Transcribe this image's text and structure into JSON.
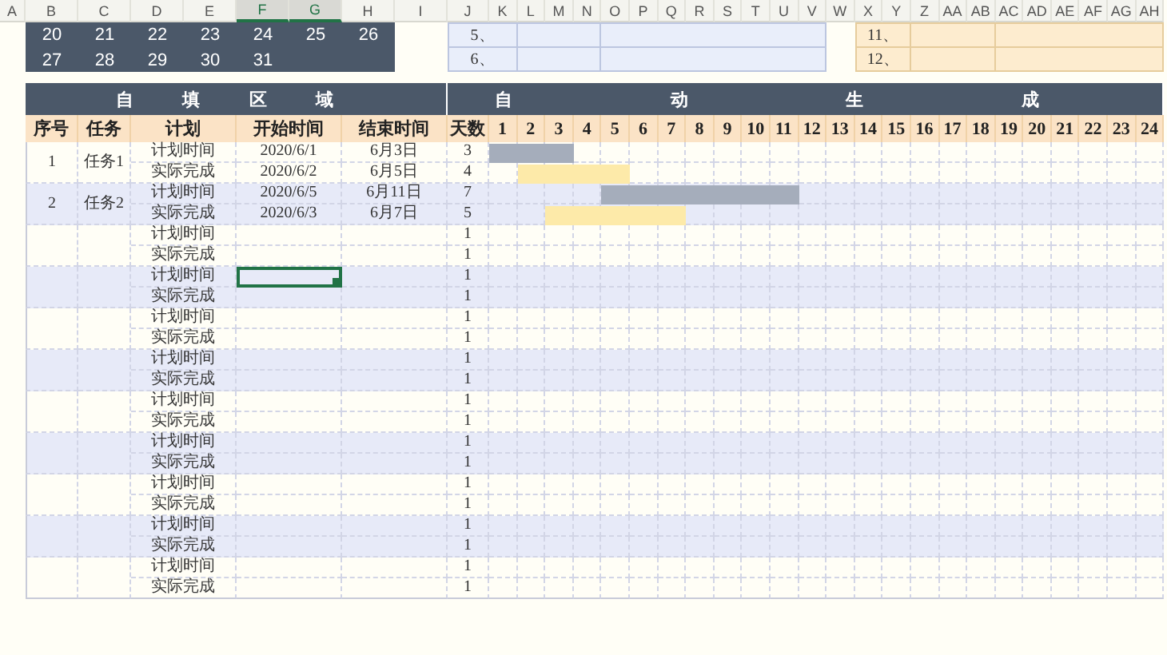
{
  "column_headers": [
    {
      "label": "A",
      "selected": false
    },
    {
      "label": "B",
      "selected": false
    },
    {
      "label": "C",
      "selected": false
    },
    {
      "label": "D",
      "selected": false
    },
    {
      "label": "E",
      "selected": false
    },
    {
      "label": "F",
      "selected": true
    },
    {
      "label": "G",
      "selected": true
    },
    {
      "label": "H",
      "selected": false
    },
    {
      "label": "I",
      "selected": false
    },
    {
      "label": "J",
      "selected": false
    },
    {
      "label": "K",
      "selected": false
    },
    {
      "label": "L",
      "selected": false
    },
    {
      "label": "M",
      "selected": false
    },
    {
      "label": "N",
      "selected": false
    },
    {
      "label": "O",
      "selected": false
    },
    {
      "label": "P",
      "selected": false
    },
    {
      "label": "Q",
      "selected": false
    },
    {
      "label": "R",
      "selected": false
    },
    {
      "label": "S",
      "selected": false
    },
    {
      "label": "T",
      "selected": false
    },
    {
      "label": "U",
      "selected": false
    },
    {
      "label": "V",
      "selected": false
    },
    {
      "label": "W",
      "selected": false
    },
    {
      "label": "X",
      "selected": false
    },
    {
      "label": "Y",
      "selected": false
    },
    {
      "label": "Z",
      "selected": false
    },
    {
      "label": "AA",
      "selected": false
    },
    {
      "label": "AB",
      "selected": false
    },
    {
      "label": "AC",
      "selected": false
    },
    {
      "label": "AD",
      "selected": false
    },
    {
      "label": "AE",
      "selected": false
    },
    {
      "label": "AF",
      "selected": false
    },
    {
      "label": "AG",
      "selected": false
    },
    {
      "label": "AH",
      "selected": false
    }
  ],
  "calendar": {
    "rows": [
      [
        "20",
        "21",
        "22",
        "23",
        "24",
        "25",
        "26"
      ],
      [
        "27",
        "28",
        "29",
        "30",
        "31"
      ]
    ]
  },
  "notes_left": [
    "5、",
    "6、"
  ],
  "notes_right": [
    "11、",
    "12、"
  ],
  "sections": [
    "自 填 区 域",
    "自 动 生 成"
  ],
  "table": {
    "columns": [
      "序号",
      "任务",
      "计划",
      "开始时间",
      "结束时间",
      "天数"
    ],
    "day_columns": [
      "1",
      "2",
      "3",
      "4",
      "5",
      "6",
      "7",
      "8",
      "9",
      "10",
      "11",
      "12",
      "13",
      "14",
      "15",
      "16",
      "17",
      "18",
      "19",
      "20",
      "21",
      "22",
      "23",
      "24"
    ],
    "tasks": [
      {
        "no": "1",
        "task": "任务1",
        "entries": [
          {
            "kind": "plan",
            "label": "计划时间",
            "start": "2020/6/1",
            "end": "6月3日",
            "days": "3",
            "selected": false
          },
          {
            "kind": "actual",
            "label": "实际完成",
            "start": "2020/6/2",
            "end": "6月5日",
            "days": "4",
            "selected": false
          }
        ]
      },
      {
        "no": "2",
        "task": "任务2",
        "entries": [
          {
            "kind": "plan",
            "label": "计划时间",
            "start": "2020/6/5",
            "end": "6月11日",
            "days": "7",
            "selected": false
          },
          {
            "kind": "actual",
            "label": "实际完成",
            "start": "2020/6/3",
            "end": "6月7日",
            "days": "5",
            "selected": false
          }
        ]
      },
      {
        "entries": [
          {
            "kind": "plan",
            "label": "计划时间",
            "days": "1",
            "selected": false
          },
          {
            "kind": "actual",
            "label": "实际完成",
            "days": "1",
            "selected": false
          }
        ]
      },
      {
        "entries": [
          {
            "kind": "plan",
            "label": "计划时间",
            "days": "1",
            "selected": true
          },
          {
            "kind": "actual",
            "label": "实际完成",
            "days": "1",
            "selected": false
          }
        ]
      },
      {
        "entries": [
          {
            "kind": "plan",
            "label": "计划时间",
            "days": "1",
            "selected": false
          },
          {
            "kind": "actual",
            "label": "实际完成",
            "days": "1",
            "selected": false
          }
        ]
      },
      {
        "entries": [
          {
            "kind": "plan",
            "label": "计划时间",
            "days": "1",
            "selected": false
          },
          {
            "kind": "actual",
            "label": "实际完成",
            "days": "1",
            "selected": false
          }
        ]
      },
      {
        "entries": [
          {
            "kind": "plan",
            "label": "计划时间",
            "days": "1",
            "selected": false
          },
          {
            "kind": "actual",
            "label": "实际完成",
            "days": "1",
            "selected": false
          }
        ]
      },
      {
        "entries": [
          {
            "kind": "plan",
            "label": "计划时间",
            "days": "1",
            "selected": false
          },
          {
            "kind": "actual",
            "label": "实际完成",
            "days": "1",
            "selected": false
          }
        ]
      },
      {
        "entries": [
          {
            "kind": "plan",
            "label": "计划时间",
            "days": "1",
            "selected": false
          },
          {
            "kind": "actual",
            "label": "实际完成",
            "days": "1",
            "selected": false
          }
        ]
      },
      {
        "entries": [
          {
            "kind": "plan",
            "label": "计划时间",
            "days": "1",
            "selected": false
          },
          {
            "kind": "actual",
            "label": "实际完成",
            "days": "1",
            "selected": false
          }
        ]
      },
      {
        "entries": [
          {
            "kind": "plan",
            "label": "计划时间",
            "days": "1",
            "selected": false
          },
          {
            "kind": "actual",
            "label": "实际完成",
            "days": "1",
            "selected": false
          }
        ]
      }
    ]
  }
}
